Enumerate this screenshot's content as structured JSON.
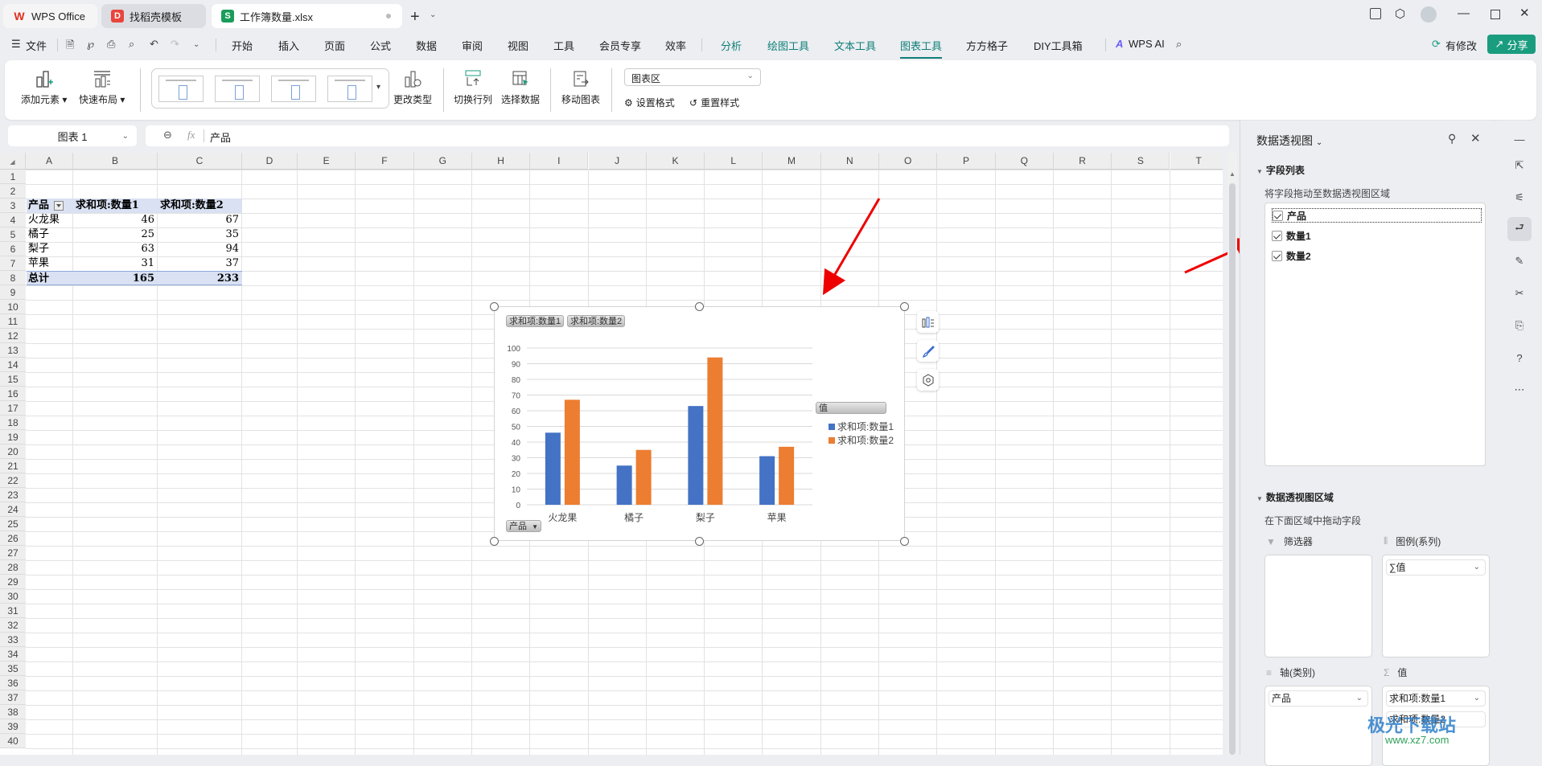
{
  "tabs": [
    {
      "label": "WPS Office",
      "icon": "wps-logo-icon"
    },
    {
      "label": "找稻壳模板",
      "icon": "docer-icon"
    },
    {
      "label": "工作簿数量.xlsx",
      "icon": "spreadsheet-icon",
      "active": true
    }
  ],
  "menu": {
    "file": "文件",
    "items": [
      "开始",
      "插入",
      "页面",
      "公式",
      "数据",
      "审阅",
      "视图",
      "工具",
      "会员专享",
      "效率"
    ],
    "context_items": [
      "分析",
      "绘图工具",
      "文本工具",
      "图表工具",
      "方方格子",
      "DIY工具箱"
    ],
    "active": "图表工具",
    "wps_ai": "WPS AI",
    "modified": "有修改",
    "share": "分享"
  },
  "ribbon": {
    "add_element": "添加元素",
    "quick_layout": "快速布局",
    "change_type": "更改类型",
    "switch_row_col": "切换行列",
    "select_data": "选择数据",
    "move_chart": "移动图表",
    "chart_area_select": "图表区",
    "set_format": "设置格式",
    "reset_style": "重置样式"
  },
  "formula_bar": {
    "name_box": "图表 1",
    "fx": "fx",
    "content": "产品"
  },
  "sheet": {
    "columns": [
      "A",
      "B",
      "C",
      "D",
      "E",
      "F",
      "G",
      "H",
      "I",
      "J",
      "K",
      "L",
      "M",
      "N",
      "O",
      "P",
      "Q",
      "R",
      "S",
      "T"
    ],
    "rows": [
      "1",
      "2",
      "3",
      "4",
      "5",
      "6",
      "7",
      "8",
      "9",
      "10",
      "11",
      "12",
      "13",
      "14",
      "15",
      "16",
      "17",
      "18",
      "19",
      "20",
      "21",
      "22",
      "23",
      "24",
      "25",
      "26",
      "27",
      "28",
      "29",
      "30",
      "31",
      "32",
      "33",
      "34",
      "35",
      "36",
      "37",
      "38",
      "39",
      "40"
    ],
    "pivot": {
      "headers": [
        "产品",
        "求和项:数量1",
        "求和项:数量2"
      ],
      "rows": [
        [
          "火龙果",
          "46",
          "67"
        ],
        [
          "橘子",
          "25",
          "35"
        ],
        [
          "梨子",
          "63",
          "94"
        ],
        [
          "苹果",
          "31",
          "37"
        ]
      ],
      "total": [
        "总计",
        "165",
        "233"
      ]
    }
  },
  "chart_data": {
    "type": "bar",
    "title": "",
    "categories": [
      "火龙果",
      "橘子",
      "梨子",
      "苹果"
    ],
    "series": [
      {
        "name": "求和项:数量1",
        "values": [
          46,
          25,
          63,
          31
        ],
        "color": "#4472c4"
      },
      {
        "name": "求和项:数量2",
        "values": [
          67,
          35,
          94,
          37
        ],
        "color": "#ed7d31"
      }
    ],
    "yticks": [
      "0",
      "10",
      "20",
      "30",
      "40",
      "50",
      "60",
      "70",
      "80",
      "90",
      "100"
    ],
    "ylim": [
      0,
      100
    ],
    "xlabel": "",
    "ylabel": "",
    "grid": true,
    "legend_title": "值",
    "legend_position": "right",
    "field_buttons": {
      "values": [
        "求和项:数量1",
        "求和项:数量2"
      ],
      "axis": "产品"
    }
  },
  "panel": {
    "title": "数据透视图",
    "field_list_title": "字段列表",
    "field_list_hint": "将字段拖动至数据透视图区域",
    "fields": [
      {
        "label": "产品",
        "checked": true
      },
      {
        "label": "数量1",
        "checked": true
      },
      {
        "label": "数量2",
        "checked": true
      }
    ],
    "areas_title": "数据透视图区域",
    "areas_hint": "在下面区域中拖动字段",
    "filter_label": "筛选器",
    "legend_label": "图例(系列)",
    "legend_items": [
      "∑值"
    ],
    "axis_label": "轴(类别)",
    "axis_items": [
      "产品"
    ],
    "values_label": "值",
    "values_items": [
      "求和项:数量1",
      "求和项:数量2"
    ]
  },
  "watermark": {
    "title": "极光下载站",
    "url": "www.xz7.com"
  }
}
